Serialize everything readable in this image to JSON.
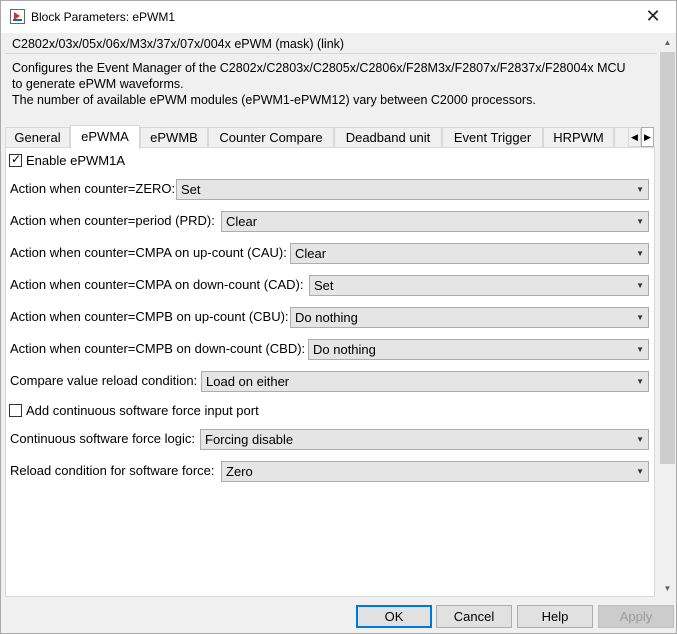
{
  "window": {
    "title": "Block Parameters: ePWM1",
    "close_glyph": "✕"
  },
  "mask": {
    "title": "C2802x/03x/05x/06x/M3x/37x/07x/004x ePWM (mask) (link)",
    "description": [
      "Configures the Event Manager of the C2802x/C2803x/C2805x/C2806x/F28M3x/F2807x/F2837x/F28004x MCU",
      "to generate ePWM waveforms.",
      "The number of available ePWM modules (ePWM1-ePWM12) vary between C2000 processors."
    ]
  },
  "tabs": [
    {
      "label": "General",
      "active": false
    },
    {
      "label": "ePWMA",
      "active": true
    },
    {
      "label": "ePWMB",
      "active": false
    },
    {
      "label": "Counter Compare",
      "active": false
    },
    {
      "label": "Deadband unit",
      "active": false
    },
    {
      "label": "Event Trigger",
      "active": false
    },
    {
      "label": "HRPWM",
      "active": false
    },
    {
      "label": "",
      "active": false
    }
  ],
  "tab_nav": {
    "prev": "◀",
    "next": "▶"
  },
  "panel": {
    "enable": {
      "label": "Enable ePWM1A",
      "checked": true
    },
    "fields": [
      {
        "label": "Action when counter=ZERO:",
        "value": "Set"
      },
      {
        "label": "Action when counter=period (PRD):",
        "value": "Clear"
      },
      {
        "label": "Action when counter=CMPA on up-count (CAU):",
        "value": "Clear"
      },
      {
        "label": "Action when counter=CMPA on down-count (CAD):",
        "value": "Set"
      },
      {
        "label": "Action when counter=CMPB on up-count (CBU):",
        "value": "Do nothing"
      },
      {
        "label": "Action when counter=CMPB on down-count (CBD):",
        "value": "Do nothing"
      },
      {
        "label": "Compare value reload condition:",
        "value": "Load on either"
      }
    ],
    "continuous_force": {
      "label": "Add continuous software force input port",
      "checked": false
    },
    "fields2": [
      {
        "label": "Continuous software force logic:",
        "value": "Forcing disable"
      },
      {
        "label": "Reload condition for software force:",
        "value": "Zero"
      }
    ]
  },
  "buttons": {
    "ok": "OK",
    "cancel": "Cancel",
    "help": "Help",
    "apply": "Apply"
  },
  "icons": {
    "caret": "▼",
    "scroll_up": "▲",
    "scroll_down": "▼",
    "check": "✓"
  }
}
